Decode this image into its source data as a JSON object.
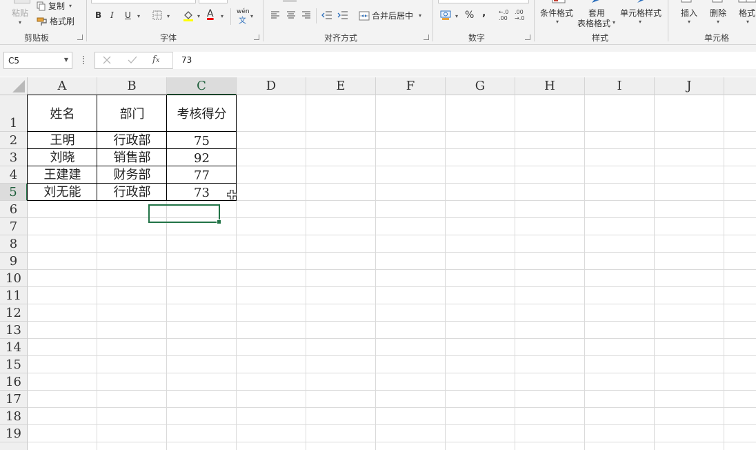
{
  "ribbon": {
    "clipboard": {
      "paste": "粘贴",
      "copy": "复制",
      "format_painter": "格式刷",
      "group": "剪贴板"
    },
    "font": {
      "bold": "B",
      "italic": "I",
      "underline": "U",
      "font_color": "A",
      "phonetic": "wén",
      "group": "字体"
    },
    "alignment": {
      "merge_center": "合并后居中",
      "group": "对齐方式"
    },
    "number": {
      "percent": "%",
      "comma": ",",
      "inc_decimal": "←.0 .00",
      "dec_decimal": ".00 →.0",
      "group": "数字"
    },
    "styles": {
      "conditional_format": "条件格式",
      "format_table_1": "套用",
      "format_table_2": "表格格式",
      "cell_styles": "单元格样式",
      "group": "样式"
    },
    "cells": {
      "insert": "插入",
      "delete": "删除",
      "format": "格式",
      "group": "单元格"
    }
  },
  "formula_bar": {
    "name_box": "C5",
    "formula": "73"
  },
  "grid": {
    "columns": [
      "A",
      "B",
      "C",
      "D",
      "E",
      "F",
      "G",
      "H",
      "I",
      "J"
    ],
    "rows": [
      "1",
      "2",
      "3",
      "4",
      "5",
      "6",
      "7",
      "8",
      "9",
      "10",
      "11",
      "12",
      "13",
      "14",
      "15",
      "16",
      "17",
      "18",
      "19"
    ],
    "data": [
      [
        "姓名",
        "部门",
        "考核得分"
      ],
      [
        "王明",
        "行政部",
        "75"
      ],
      [
        "刘晓",
        "销售部",
        "92"
      ],
      [
        "王建建",
        "财务部",
        "77"
      ],
      [
        "刘无能",
        "行政部",
        "73"
      ]
    ]
  },
  "colors": {
    "accent": "#217346",
    "grid_line": "#dadada",
    "header_bg": "#efefef"
  }
}
